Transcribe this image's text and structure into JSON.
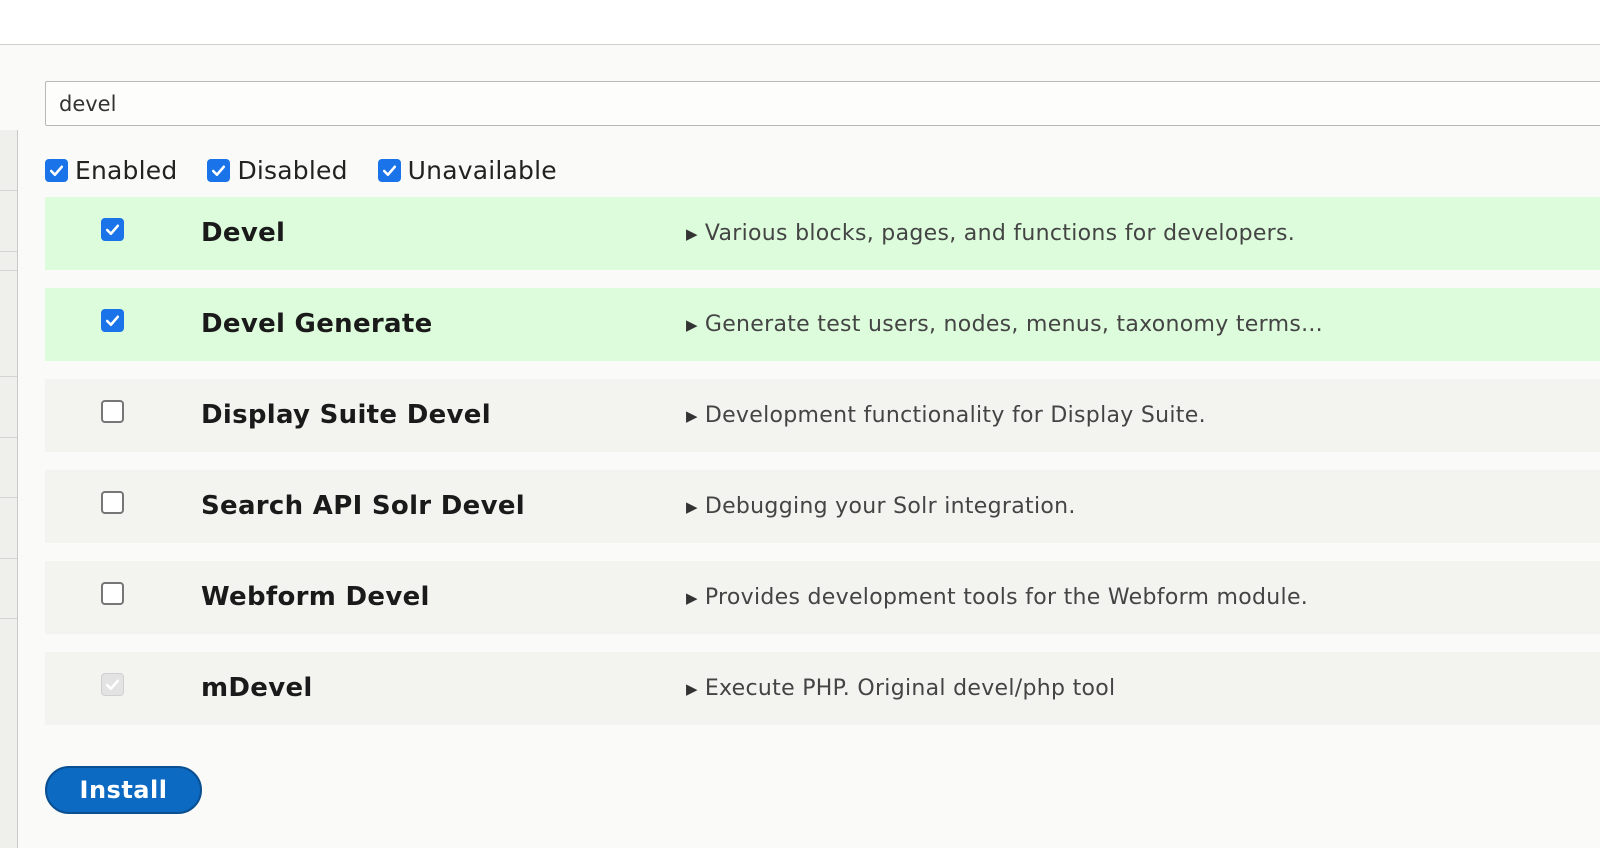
{
  "search": {
    "value": "devel"
  },
  "filters": [
    {
      "label": "Enabled",
      "checked": true
    },
    {
      "label": "Disabled",
      "checked": true
    },
    {
      "label": "Unavailable",
      "checked": true
    }
  ],
  "modules": [
    {
      "name": "Devel",
      "description": "Various blocks, pages, and functions for developers.",
      "checked": true,
      "status": "enabled"
    },
    {
      "name": "Devel Generate",
      "description": "Generate test users, nodes, menus, taxonomy terms...",
      "checked": true,
      "status": "enabled"
    },
    {
      "name": "Display Suite Devel",
      "description": "Development functionality for Display Suite.",
      "checked": false,
      "status": "disabled"
    },
    {
      "name": "Search API Solr Devel",
      "description": "Debugging your Solr integration.",
      "checked": false,
      "status": "disabled"
    },
    {
      "name": "Webform Devel",
      "description": "Provides development tools for the Webform module.",
      "checked": false,
      "status": "disabled"
    },
    {
      "name": "mDevel",
      "description": "Execute PHP. Original devel/php tool",
      "checked": true,
      "status": "unavailable"
    }
  ],
  "actions": {
    "install_label": "Install"
  },
  "colors": {
    "checkbox_accent": "#1a73e8",
    "enabled_row": "#ddfcdc",
    "disabled_row": "#f3f3f0",
    "install_button": "#0c6ac2"
  },
  "icons": {
    "description_toggle": "triangle-right-icon",
    "checkmark": "checkmark-icon"
  }
}
